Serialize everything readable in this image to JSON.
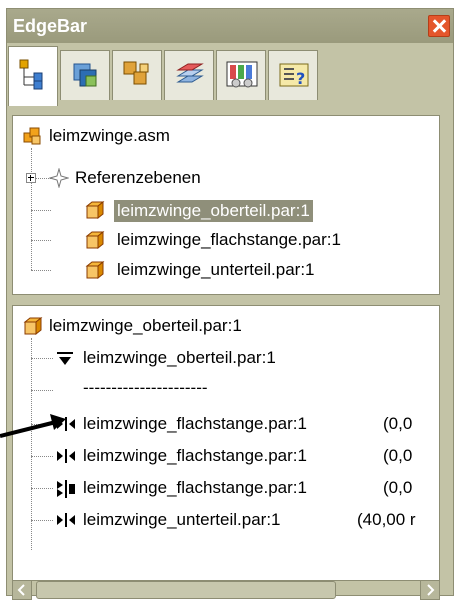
{
  "window": {
    "title": "EdgeBar"
  },
  "tabs": [
    {
      "name": "pathfinder"
    },
    {
      "name": "layers"
    },
    {
      "name": "assembly"
    },
    {
      "name": "sheets"
    },
    {
      "name": "properties"
    },
    {
      "name": "help"
    }
  ],
  "tree_top": {
    "root": "leimzwinge.asm",
    "items": [
      {
        "label": "Referenzebenen"
      },
      {
        "label": "leimzwinge_oberteil.par:1",
        "selected": true
      },
      {
        "label": "leimzwinge_flachstange.par:1"
      },
      {
        "label": "leimzwinge_unterteil.par:1"
      }
    ]
  },
  "tree_bottom": {
    "root": "leimzwinge_oberteil.par:1",
    "items": [
      {
        "label": "leimzwinge_oberteil.par:1",
        "icon": "ground-icon"
      },
      {
        "label": "----------------------"
      },
      {
        "label": "leimzwinge_flachstange.par:1",
        "extra": "(0,0",
        "icon": "mate-icon"
      },
      {
        "label": "leimzwinge_flachstange.par:1",
        "extra": "(0,0",
        "icon": "mate-icon"
      },
      {
        "label": "leimzwinge_flachstange.par:1",
        "extra": "(0,0",
        "icon": "align-icon"
      },
      {
        "label": "leimzwinge_unterteil.par:1",
        "extra": "(40,00 r",
        "icon": "mate-icon"
      }
    ]
  }
}
